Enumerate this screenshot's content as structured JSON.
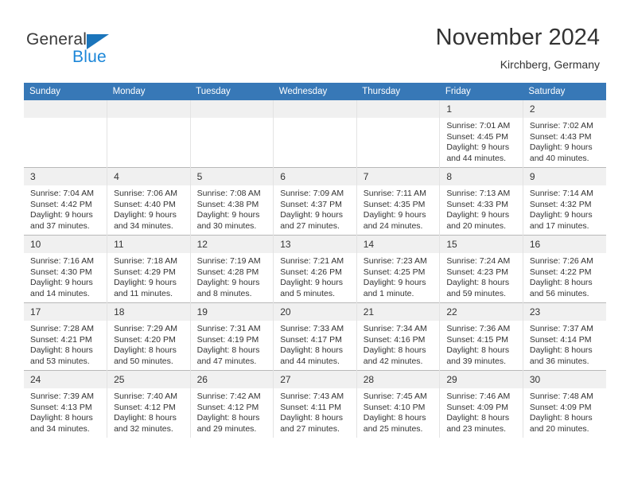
{
  "brand": {
    "name_part1": "General",
    "name_part2": "Blue",
    "color_primary": "#1b75bb",
    "color_secondary": "#1b86d8"
  },
  "header": {
    "title": "November 2024",
    "subtitle": "Kirchberg, Germany"
  },
  "theme": {
    "header_row_bg": "#3778b7",
    "daynum_bg": "#f0f0f0",
    "text": "#333333"
  },
  "weekday_headers": [
    "Sunday",
    "Monday",
    "Tuesday",
    "Wednesday",
    "Thursday",
    "Friday",
    "Saturday"
  ],
  "weeks": [
    [
      {
        "day": "",
        "lines": []
      },
      {
        "day": "",
        "lines": []
      },
      {
        "day": "",
        "lines": []
      },
      {
        "day": "",
        "lines": []
      },
      {
        "day": "",
        "lines": []
      },
      {
        "day": "1",
        "lines": [
          "Sunrise: 7:01 AM",
          "Sunset: 4:45 PM",
          "Daylight: 9 hours",
          "and 44 minutes."
        ]
      },
      {
        "day": "2",
        "lines": [
          "Sunrise: 7:02 AM",
          "Sunset: 4:43 PM",
          "Daylight: 9 hours",
          "and 40 minutes."
        ]
      }
    ],
    [
      {
        "day": "3",
        "lines": [
          "Sunrise: 7:04 AM",
          "Sunset: 4:42 PM",
          "Daylight: 9 hours",
          "and 37 minutes."
        ]
      },
      {
        "day": "4",
        "lines": [
          "Sunrise: 7:06 AM",
          "Sunset: 4:40 PM",
          "Daylight: 9 hours",
          "and 34 minutes."
        ]
      },
      {
        "day": "5",
        "lines": [
          "Sunrise: 7:08 AM",
          "Sunset: 4:38 PM",
          "Daylight: 9 hours",
          "and 30 minutes."
        ]
      },
      {
        "day": "6",
        "lines": [
          "Sunrise: 7:09 AM",
          "Sunset: 4:37 PM",
          "Daylight: 9 hours",
          "and 27 minutes."
        ]
      },
      {
        "day": "7",
        "lines": [
          "Sunrise: 7:11 AM",
          "Sunset: 4:35 PM",
          "Daylight: 9 hours",
          "and 24 minutes."
        ]
      },
      {
        "day": "8",
        "lines": [
          "Sunrise: 7:13 AM",
          "Sunset: 4:33 PM",
          "Daylight: 9 hours",
          "and 20 minutes."
        ]
      },
      {
        "day": "9",
        "lines": [
          "Sunrise: 7:14 AM",
          "Sunset: 4:32 PM",
          "Daylight: 9 hours",
          "and 17 minutes."
        ]
      }
    ],
    [
      {
        "day": "10",
        "lines": [
          "Sunrise: 7:16 AM",
          "Sunset: 4:30 PM",
          "Daylight: 9 hours",
          "and 14 minutes."
        ]
      },
      {
        "day": "11",
        "lines": [
          "Sunrise: 7:18 AM",
          "Sunset: 4:29 PM",
          "Daylight: 9 hours",
          "and 11 minutes."
        ]
      },
      {
        "day": "12",
        "lines": [
          "Sunrise: 7:19 AM",
          "Sunset: 4:28 PM",
          "Daylight: 9 hours",
          "and 8 minutes."
        ]
      },
      {
        "day": "13",
        "lines": [
          "Sunrise: 7:21 AM",
          "Sunset: 4:26 PM",
          "Daylight: 9 hours",
          "and 5 minutes."
        ]
      },
      {
        "day": "14",
        "lines": [
          "Sunrise: 7:23 AM",
          "Sunset: 4:25 PM",
          "Daylight: 9 hours",
          "and 1 minute."
        ]
      },
      {
        "day": "15",
        "lines": [
          "Sunrise: 7:24 AM",
          "Sunset: 4:23 PM",
          "Daylight: 8 hours",
          "and 59 minutes."
        ]
      },
      {
        "day": "16",
        "lines": [
          "Sunrise: 7:26 AM",
          "Sunset: 4:22 PM",
          "Daylight: 8 hours",
          "and 56 minutes."
        ]
      }
    ],
    [
      {
        "day": "17",
        "lines": [
          "Sunrise: 7:28 AM",
          "Sunset: 4:21 PM",
          "Daylight: 8 hours",
          "and 53 minutes."
        ]
      },
      {
        "day": "18",
        "lines": [
          "Sunrise: 7:29 AM",
          "Sunset: 4:20 PM",
          "Daylight: 8 hours",
          "and 50 minutes."
        ]
      },
      {
        "day": "19",
        "lines": [
          "Sunrise: 7:31 AM",
          "Sunset: 4:19 PM",
          "Daylight: 8 hours",
          "and 47 minutes."
        ]
      },
      {
        "day": "20",
        "lines": [
          "Sunrise: 7:33 AM",
          "Sunset: 4:17 PM",
          "Daylight: 8 hours",
          "and 44 minutes."
        ]
      },
      {
        "day": "21",
        "lines": [
          "Sunrise: 7:34 AM",
          "Sunset: 4:16 PM",
          "Daylight: 8 hours",
          "and 42 minutes."
        ]
      },
      {
        "day": "22",
        "lines": [
          "Sunrise: 7:36 AM",
          "Sunset: 4:15 PM",
          "Daylight: 8 hours",
          "and 39 minutes."
        ]
      },
      {
        "day": "23",
        "lines": [
          "Sunrise: 7:37 AM",
          "Sunset: 4:14 PM",
          "Daylight: 8 hours",
          "and 36 minutes."
        ]
      }
    ],
    [
      {
        "day": "24",
        "lines": [
          "Sunrise: 7:39 AM",
          "Sunset: 4:13 PM",
          "Daylight: 8 hours",
          "and 34 minutes."
        ]
      },
      {
        "day": "25",
        "lines": [
          "Sunrise: 7:40 AM",
          "Sunset: 4:12 PM",
          "Daylight: 8 hours",
          "and 32 minutes."
        ]
      },
      {
        "day": "26",
        "lines": [
          "Sunrise: 7:42 AM",
          "Sunset: 4:12 PM",
          "Daylight: 8 hours",
          "and 29 minutes."
        ]
      },
      {
        "day": "27",
        "lines": [
          "Sunrise: 7:43 AM",
          "Sunset: 4:11 PM",
          "Daylight: 8 hours",
          "and 27 minutes."
        ]
      },
      {
        "day": "28",
        "lines": [
          "Sunrise: 7:45 AM",
          "Sunset: 4:10 PM",
          "Daylight: 8 hours",
          "and 25 minutes."
        ]
      },
      {
        "day": "29",
        "lines": [
          "Sunrise: 7:46 AM",
          "Sunset: 4:09 PM",
          "Daylight: 8 hours",
          "and 23 minutes."
        ]
      },
      {
        "day": "30",
        "lines": [
          "Sunrise: 7:48 AM",
          "Sunset: 4:09 PM",
          "Daylight: 8 hours",
          "and 20 minutes."
        ]
      }
    ]
  ]
}
